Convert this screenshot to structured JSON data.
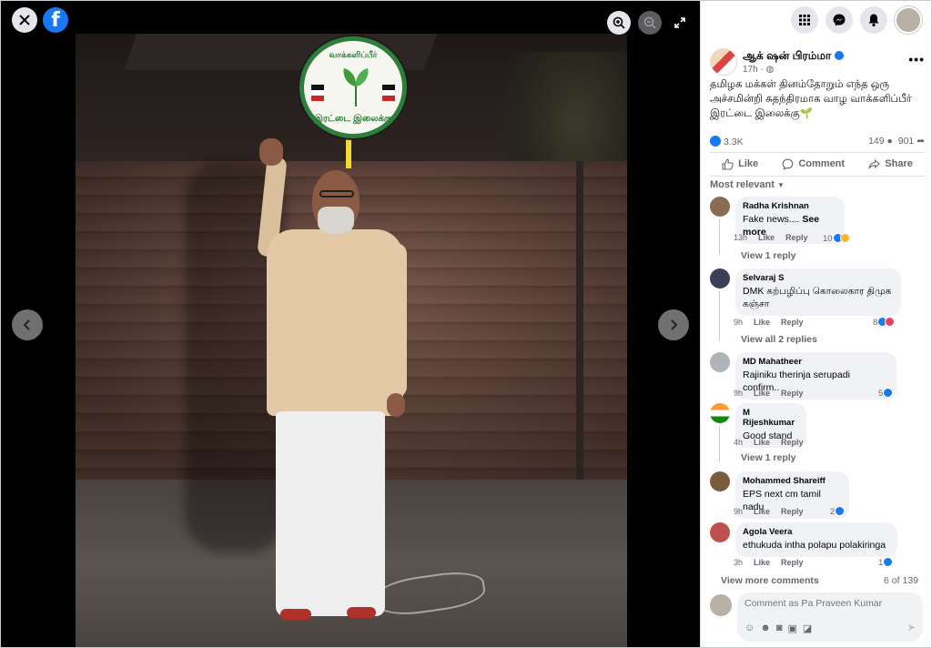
{
  "viewer": {
    "sign_top_text": "வாக்களிப்பீர்",
    "sign_bottom_text": "இரட்டை இலைக்கு",
    "logo_letter": "f"
  },
  "panel": {
    "page_name": "ஆக் ஷன் பிரம்மா",
    "post_time": "17h ·",
    "post_text": "தமிழக மக்கள் தினம்தோறும் எந்த ஒரு அச்சமின்றி சுதந்திரமாக வாழ வாக்களிப்பீர் இரட்டை இலைக்கு🌱",
    "reactions_count": "3.3K",
    "comments_count": "149",
    "shares_count": "901",
    "actions": {
      "like": "Like",
      "comment": "Comment",
      "share": "Share"
    },
    "sort_label": "Most relevant",
    "comments": [
      {
        "author": "Radha Krishnan",
        "text": "Fake news....",
        "see_more": "See more",
        "time": "13h",
        "like": "Like",
        "reply": "Reply",
        "reactions": "10",
        "replies": "View 1 reply",
        "colors": [
          "#1877f2",
          "#f7b928"
        ]
      },
      {
        "author": "Selvaraj S",
        "text": "DMK கற்பழிப்பு கொலைகார திமுக கஞ்சா",
        "time": "9h",
        "like": "Like",
        "reply": "Reply",
        "reactions": "8",
        "replies": "View all 2 replies",
        "colors": [
          "#1877f2",
          "#f33e58"
        ]
      },
      {
        "author": "MD Mahatheer",
        "text": "Rajiniku therinja serupadi confirm..",
        "time": "9h",
        "like": "Like",
        "reply": "Reply",
        "reactions": "5",
        "replies": "",
        "colors": [
          "#1877f2"
        ]
      },
      {
        "author": "M Rijeshkumar",
        "text": "Good stand",
        "time": "4h",
        "like": "Like",
        "reply": "Reply",
        "reactions": "",
        "replies": "View 1 reply",
        "colors": []
      },
      {
        "author": "Mohammed Shareiff",
        "text": "EPS next cm tamil nadu",
        "time": "9h",
        "like": "Like",
        "reply": "Reply",
        "reactions": "2",
        "replies": "",
        "colors": [
          "#1877f2"
        ]
      },
      {
        "author": "Agola Veera",
        "text": "ethukuda intha polapu polakiringa",
        "time": "3h",
        "like": "Like",
        "reply": "Reply",
        "reactions": "1",
        "replies": "",
        "colors": [
          "#1877f2"
        ]
      }
    ],
    "view_more": "View more comments",
    "count_of": "6 of 139",
    "composer_placeholder": "Comment as Pa Praveen Kumar"
  },
  "icons": {
    "close": "close-icon",
    "facebook": "facebook-logo-icon",
    "zoom_in": "zoom-in-icon",
    "zoom_out": "zoom-out-icon",
    "fullscreen": "fullscreen-icon",
    "prev": "chevron-left-icon",
    "next": "chevron-right-icon",
    "menu": "grid-menu-icon",
    "messenger": "messenger-icon",
    "notifications": "bell-icon"
  },
  "colors": {
    "brand": "#1877f2",
    "leaf_green": "#2e7d3a",
    "panel_bg": "#ffffff",
    "bubble_bg": "#f0f2f5"
  }
}
